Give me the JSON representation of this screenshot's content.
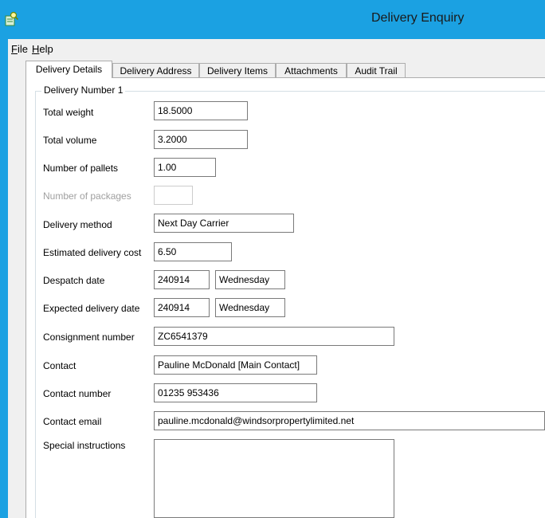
{
  "window": {
    "title": "Delivery Enquiry",
    "icon": "search-document-icon",
    "accent_color": "#1ba1e2"
  },
  "menu": {
    "items": [
      {
        "label_first": "F",
        "label_rest": "ile"
      },
      {
        "label_first": "H",
        "label_rest": "elp"
      }
    ]
  },
  "tabs": [
    {
      "label": "Delivery Details",
      "active": true
    },
    {
      "label": "Delivery Address",
      "active": false
    },
    {
      "label": "Delivery Items",
      "active": false
    },
    {
      "label": "Attachments",
      "active": false
    },
    {
      "label": "Audit Trail",
      "active": false
    }
  ],
  "group": {
    "legend": "Delivery Number 1"
  },
  "form": {
    "total_weight": {
      "label": "Total weight",
      "value": "18.5000"
    },
    "total_volume": {
      "label": "Total volume",
      "value": "3.2000"
    },
    "number_of_pallets": {
      "label": "Number of pallets",
      "value": "1.00"
    },
    "number_of_packages": {
      "label": "Number of packages",
      "value": ""
    },
    "delivery_method": {
      "label": "Delivery method",
      "value": "Next Day Carrier"
    },
    "estimated_delivery_cost": {
      "label": "Estimated delivery cost",
      "value": "6.50"
    },
    "despatch_date": {
      "label": "Despatch date",
      "value": "240914",
      "day": "Wednesday"
    },
    "expected_delivery_date": {
      "label": "Expected delivery date",
      "value": "240914",
      "day": "Wednesday"
    },
    "consignment_number": {
      "label": "Consignment number",
      "value": "ZC6541379"
    },
    "contact": {
      "label": "Contact",
      "value": "Pauline McDonald [Main Contact]"
    },
    "contact_number": {
      "label": "Contact number",
      "value": "01235 953436"
    },
    "contact_email": {
      "label": "Contact email",
      "value": "pauline.mcdonald@windsorpropertylimited.net"
    },
    "special_instructions": {
      "label": "Special instructions",
      "value": ""
    }
  }
}
